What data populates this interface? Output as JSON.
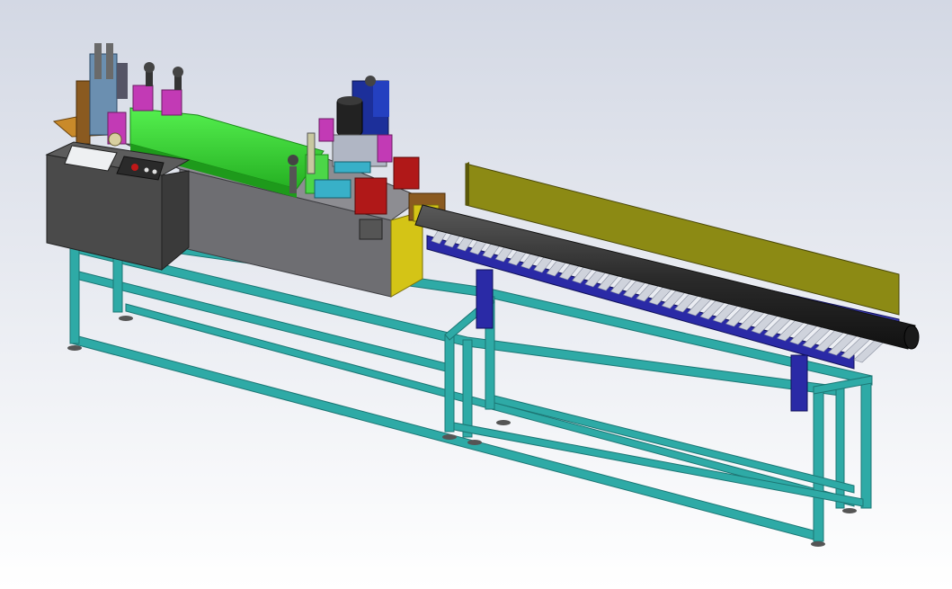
{
  "scene": {
    "background_top": "#d3d8e4",
    "background_bottom": "#ffffff"
  },
  "colors": {
    "frame": "#2eaaa6",
    "frame_dark": "#1c7674",
    "frame_light": "#67d0cc",
    "cabinet": "#4a4a4a",
    "cabinet_side": "#3a3a3a",
    "body_grey": "#6e6e72",
    "green_housing": "#3ee23a",
    "motor": "#222222",
    "blue_mount": "#1c2f9a",
    "conveyor_rail": "#2a2aa6",
    "roller": "#cfd3dc",
    "guide_plate": "#8c8a14",
    "pipe": "#2b2b2b",
    "magenta": "#c23ab5",
    "brown": "#8a5a20",
    "red": "#b01818",
    "yellow_block": "#d4c416",
    "screen": "#eef0f2"
  },
  "labels": []
}
